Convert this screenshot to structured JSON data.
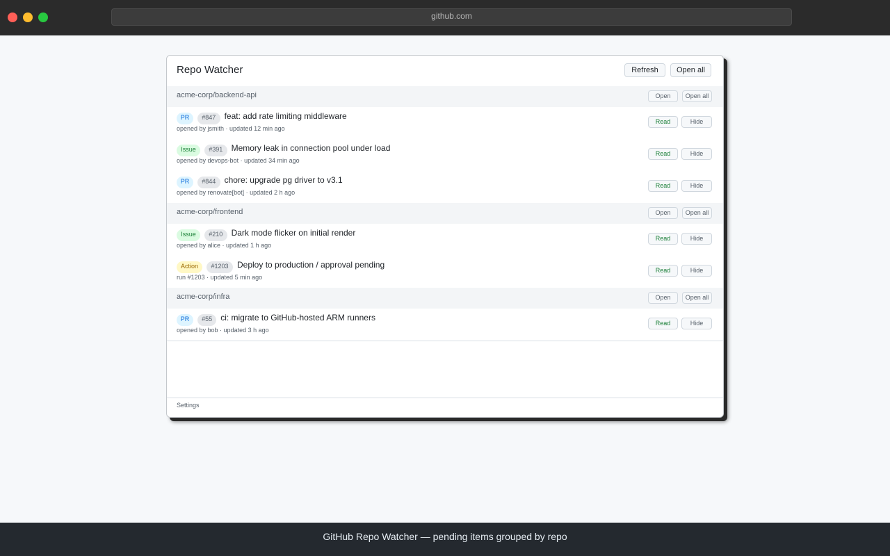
{
  "browser": {
    "url": "github.com"
  },
  "popup": {
    "title": "Repo Watcher",
    "refresh_label": "Refresh",
    "open_all_label": "Open all",
    "settings_label": "Settings"
  },
  "labels": {
    "open": "Open",
    "open_all": "Open all",
    "read": "Read",
    "hide": "Hide"
  },
  "groups": [
    {
      "repo": "acme-corp/backend-api",
      "items": [
        {
          "type": "PR",
          "number": "#847",
          "title": "feat: add rate limiting middleware",
          "meta": "opened by jsmith · updated 12 min ago"
        },
        {
          "type": "Issue",
          "number": "#391",
          "title": "Memory leak in connection pool under load",
          "meta": "opened by devops-bot · updated 34 min ago"
        },
        {
          "type": "PR",
          "number": "#844",
          "title": "chore: upgrade pg driver to v3.1",
          "meta": "opened by renovate[bot] · updated 2 h ago"
        }
      ]
    },
    {
      "repo": "acme-corp/frontend",
      "items": [
        {
          "type": "Issue",
          "number": "#210",
          "title": "Dark mode flicker on initial render",
          "meta": "opened by alice · updated 1 h ago"
        },
        {
          "type": "Action",
          "number": "#1203",
          "title": "Deploy to production / approval pending",
          "meta": "run #1203 · updated 5 min ago"
        }
      ]
    },
    {
      "repo": "acme-corp/infra",
      "items": [
        {
          "type": "PR",
          "number": "#55",
          "title": "ci: migrate to GitHub-hosted ARM runners",
          "meta": "opened by bob · updated 3 h ago"
        }
      ]
    }
  ],
  "caption": "GitHub Repo Watcher — pending items grouped by repo",
  "colors": {
    "pr_badge": "#0969da",
    "issue_badge": "#1a7f37",
    "action_badge": "#9a6700",
    "read_button": "#1a7f37",
    "caption_bar": "#24292f"
  }
}
